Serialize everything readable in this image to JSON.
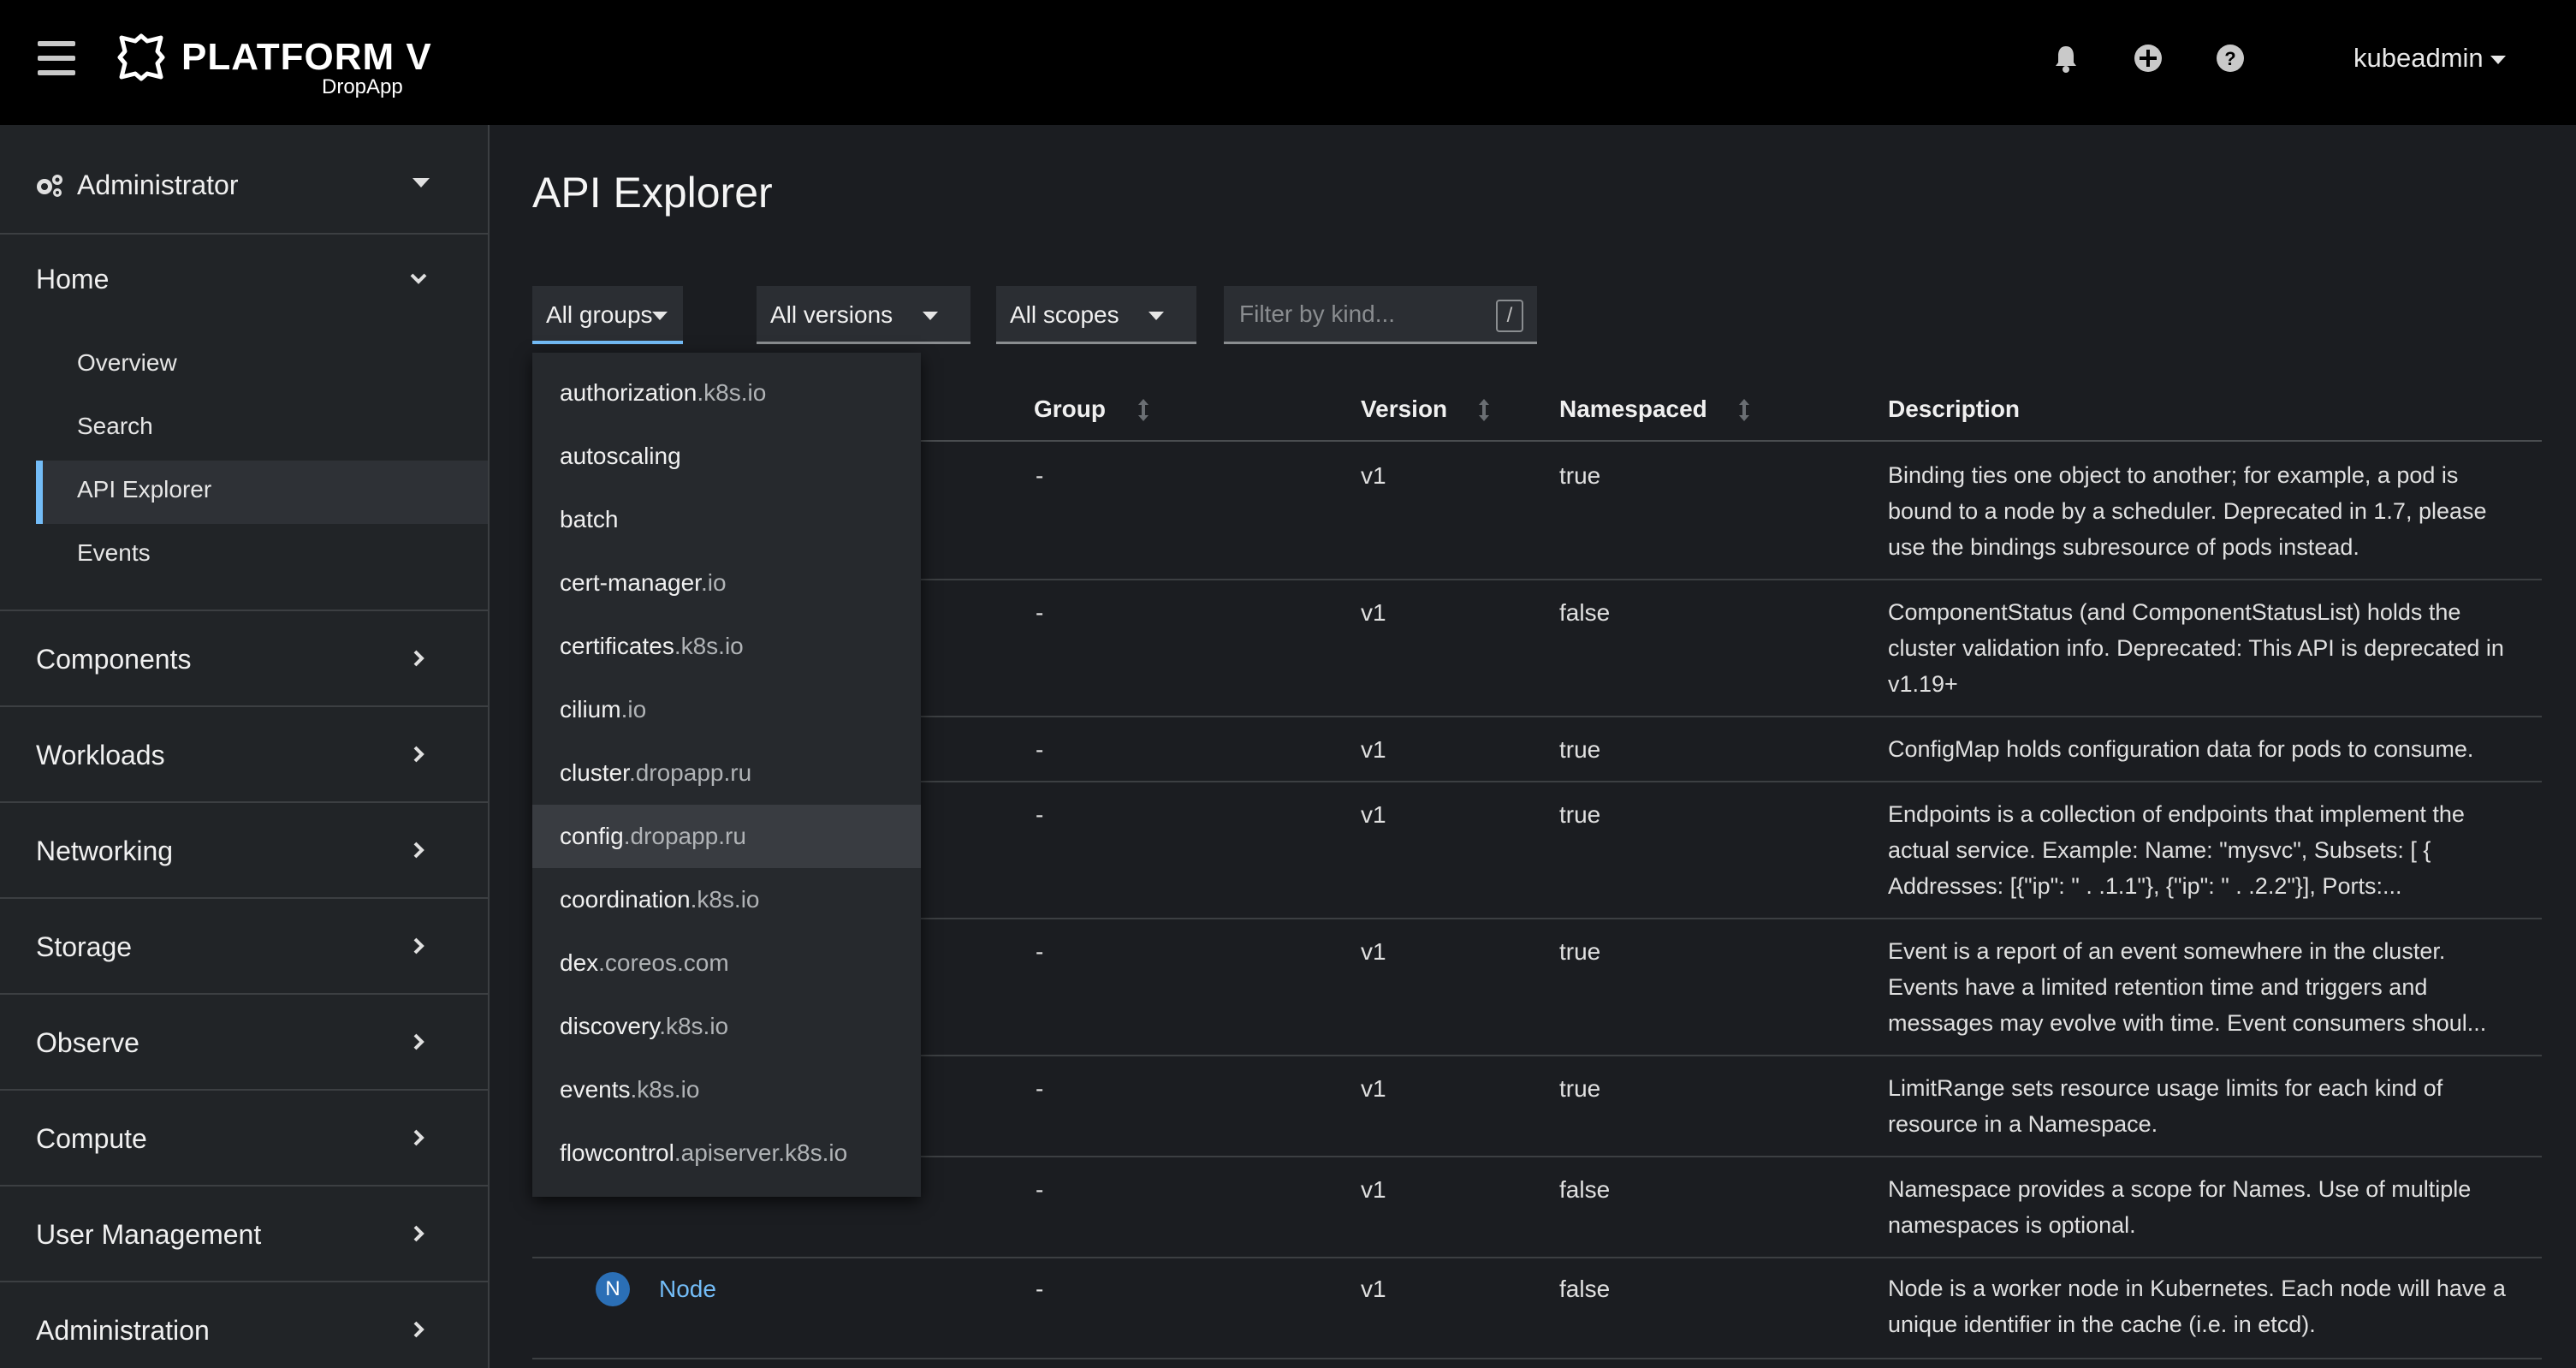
{
  "masthead": {
    "brand": "PLATFORM V",
    "brand_sub": "DropApp",
    "user": "kubeadmin",
    "icons": [
      "bell-icon",
      "plus-circle-icon",
      "question-circle-icon"
    ]
  },
  "sidebar": {
    "perspective": "Administrator",
    "home": {
      "title": "Home",
      "items": [
        "Overview",
        "Search",
        "API Explorer",
        "Events"
      ],
      "active": "API Explorer"
    },
    "sections": [
      "Components",
      "Workloads",
      "Networking",
      "Storage",
      "Observe",
      "Compute",
      "User Management",
      "Administration"
    ]
  },
  "main": {
    "title": "API Explorer",
    "filters": {
      "groups": "All groups",
      "versions": "All versions",
      "scopes": "All scopes",
      "kind_placeholder": "Filter by kind...",
      "kind_shortcut": "/"
    },
    "columns": [
      "Group",
      "Version",
      "Namespaced",
      "Description"
    ],
    "rows": [
      {
        "group": "-",
        "version": "v1",
        "namespaced": "true",
        "description": "Binding ties one object to another; for example, a pod is bound to a node by a scheduler. Deprecated in 1.7, please use the bindings subresource of pods instead."
      },
      {
        "group": "-",
        "version": "v1",
        "namespaced": "false",
        "description": "ComponentStatus (and ComponentStatusList) holds the cluster validation info. Deprecated: This API is deprecated in v1.19+"
      },
      {
        "group": "-",
        "version": "v1",
        "namespaced": "true",
        "description": "ConfigMap holds configuration data for pods to consume."
      },
      {
        "group": "-",
        "version": "v1",
        "namespaced": "true",
        "description": "Endpoints is a collection of endpoints that implement the actual service. Example: Name: \"mysvc\", Subsets: [ { Addresses: [{\"ip\": \"   .   .1.1\"}, {\"ip\": \"   .   .2.2\"}], Ports:..."
      },
      {
        "group": "-",
        "version": "v1",
        "namespaced": "true",
        "description": "Event is a report of an event somewhere in the cluster. Events have a limited retention time and triggers and messages may evolve with time. Event consumers shoul..."
      },
      {
        "group": "-",
        "version": "v1",
        "namespaced": "true",
        "description": "LimitRange sets resource usage limits for each kind of resource in a Namespace."
      },
      {
        "group": "-",
        "version": "v1",
        "namespaced": "false",
        "description": "Namespace provides a scope for Names. Use of multiple namespaces is optional."
      },
      {
        "badge": "N",
        "kind": "Node",
        "group": "-",
        "version": "v1",
        "namespaced": "false",
        "description": "Node is a worker node in Kubernetes. Each node will have a unique identifier in the cache (i.e. in etcd)."
      }
    ]
  },
  "groups_menu": [
    {
      "base": "authorization",
      "suffix": ".k8s.io"
    },
    {
      "base": "autoscaling",
      "suffix": ""
    },
    {
      "base": "batch",
      "suffix": ""
    },
    {
      "base": "cert-manager",
      "suffix": ".io"
    },
    {
      "base": "certificates",
      "suffix": ".k8s.io"
    },
    {
      "base": "cilium",
      "suffix": ".io"
    },
    {
      "base": "cluster",
      "suffix": ".dropapp.ru"
    },
    {
      "base": "config",
      "suffix": ".dropapp.ru"
    },
    {
      "base": "coordination",
      "suffix": ".k8s.io"
    },
    {
      "base": "dex",
      "suffix": ".coreos.com"
    },
    {
      "base": "discovery",
      "suffix": ".k8s.io"
    },
    {
      "base": "events",
      "suffix": ".k8s.io"
    },
    {
      "base": "flowcontrol",
      "suffix": ".apiserver.k8s.io"
    }
  ],
  "groups_menu_highlighted": "config.dropapp.ru"
}
